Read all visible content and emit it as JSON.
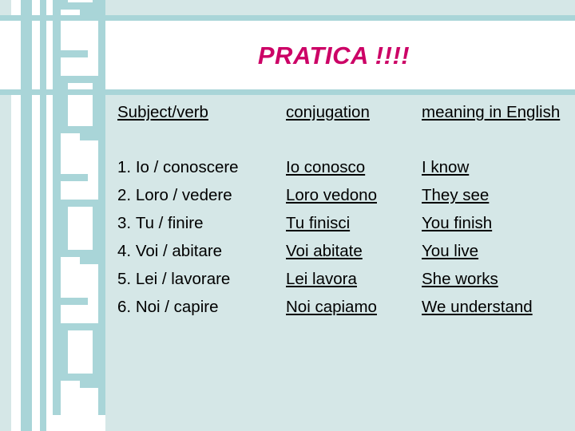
{
  "slide": {
    "title": "PRATICA !!!!",
    "title_color": "#cc0066",
    "background_color": "#d5e7e7",
    "band_color": "#ffffff",
    "accent_color": "#a9d5d8"
  },
  "table": {
    "headers": {
      "subject": "Subject/verb",
      "conjugation": "conjugation",
      "meaning": "meaning in English"
    },
    "rows": [
      {
        "number": "1.",
        "subject": "Io / conoscere",
        "conjugation": " Io conosco ",
        "meaning": " I know "
      },
      {
        "number": "2.",
        "subject": "Loro / vedere",
        "conjugation": " Loro vedono ",
        "meaning": " They see "
      },
      {
        "number": "3.",
        "subject": "Tu / finire",
        "conjugation": " Tu finisci ",
        "meaning": " You finish "
      },
      {
        "number": "4.",
        "subject": "Voi / abitare",
        "conjugation": " Voi abitate ",
        "meaning": " You live "
      },
      {
        "number": "5.",
        "subject": "Lei / lavorare",
        "conjugation": " Lei lavora ",
        "meaning": " She works "
      },
      {
        "number": "6.",
        "subject": "Noi / capire",
        "conjugation": " Noi capiamo ",
        "meaning": " We understand "
      }
    ]
  },
  "decoration": {
    "name": "geometric-border-pattern",
    "stripe_color": "#a9d5d8",
    "tile_color": "#ffffff"
  }
}
